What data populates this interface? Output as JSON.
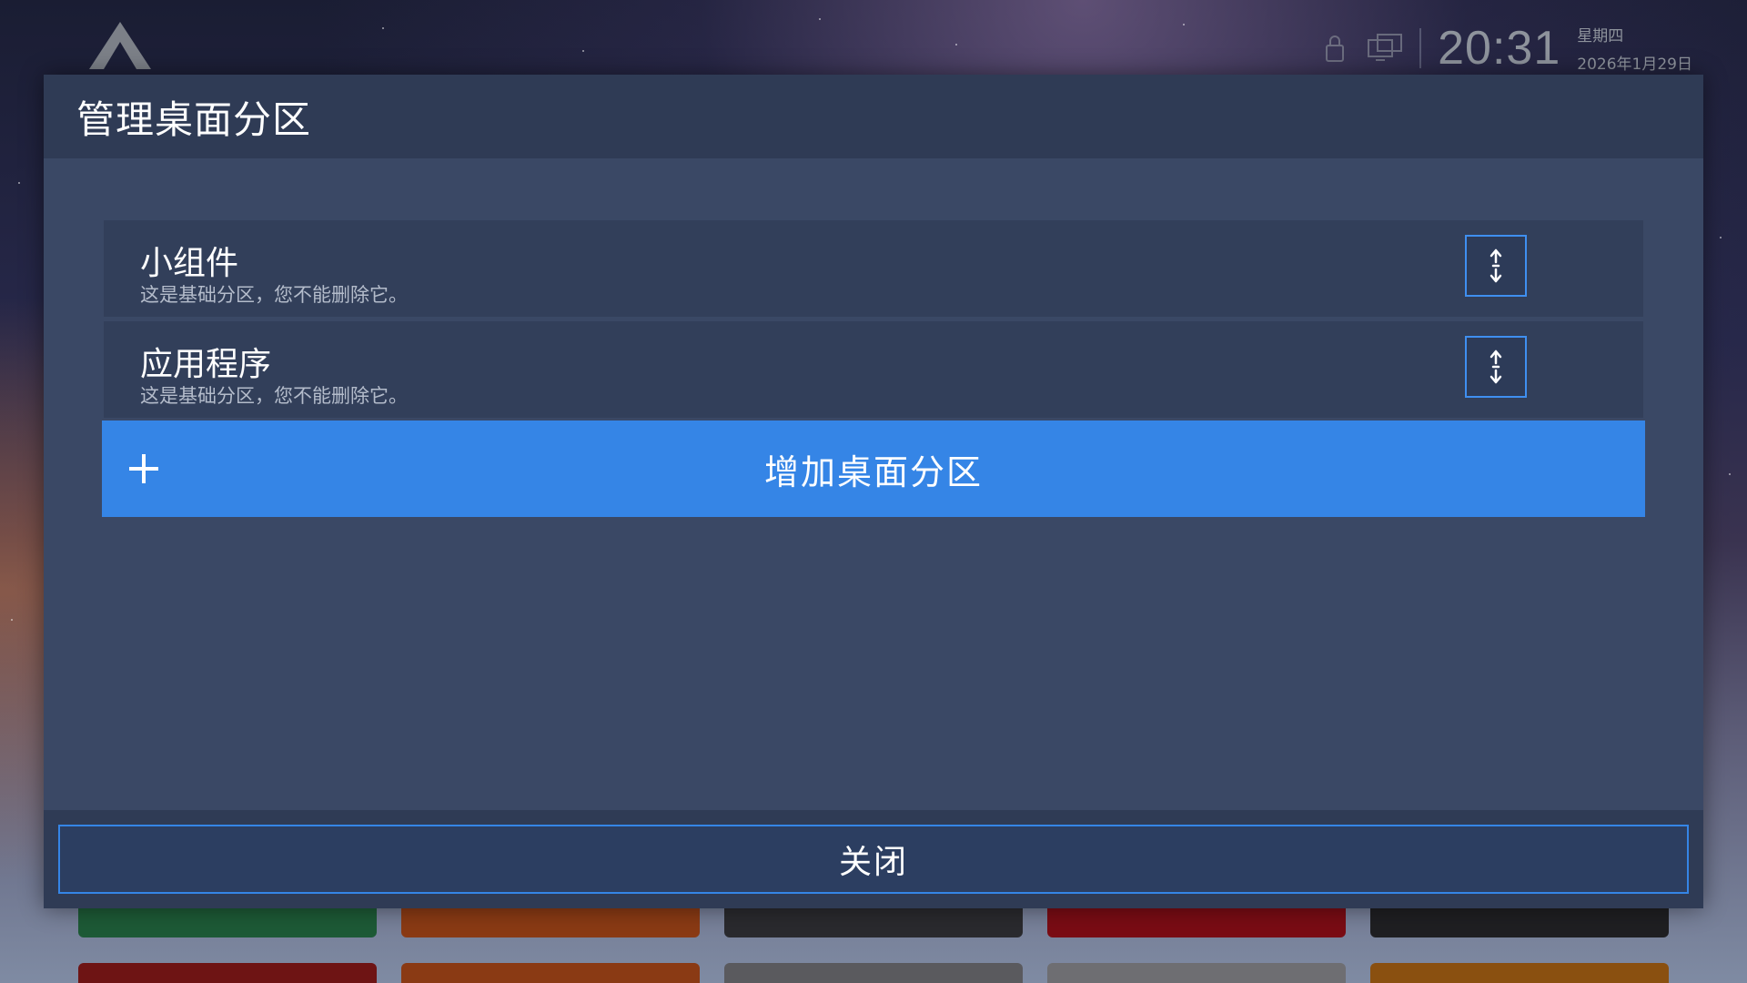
{
  "status_bar": {
    "time": "20:31",
    "weekday": "星期四",
    "date": "2026年1月29日",
    "icons": [
      "lock-icon",
      "network-screen-icon"
    ]
  },
  "dialog": {
    "title": "管理桌面分区",
    "sections": [
      {
        "name": "小组件",
        "description": "这是基础分区，您不能删除它。"
      },
      {
        "name": "应用程序",
        "description": "这是基础分区，您不能删除它。"
      }
    ],
    "add_section_label": "增加桌面分区",
    "close_label": "关闭"
  },
  "colors": {
    "accent": "#3585e6",
    "dialog_bg": "#3a4865",
    "header_bg": "#2f3b55",
    "row_bg": "#323f5a"
  }
}
